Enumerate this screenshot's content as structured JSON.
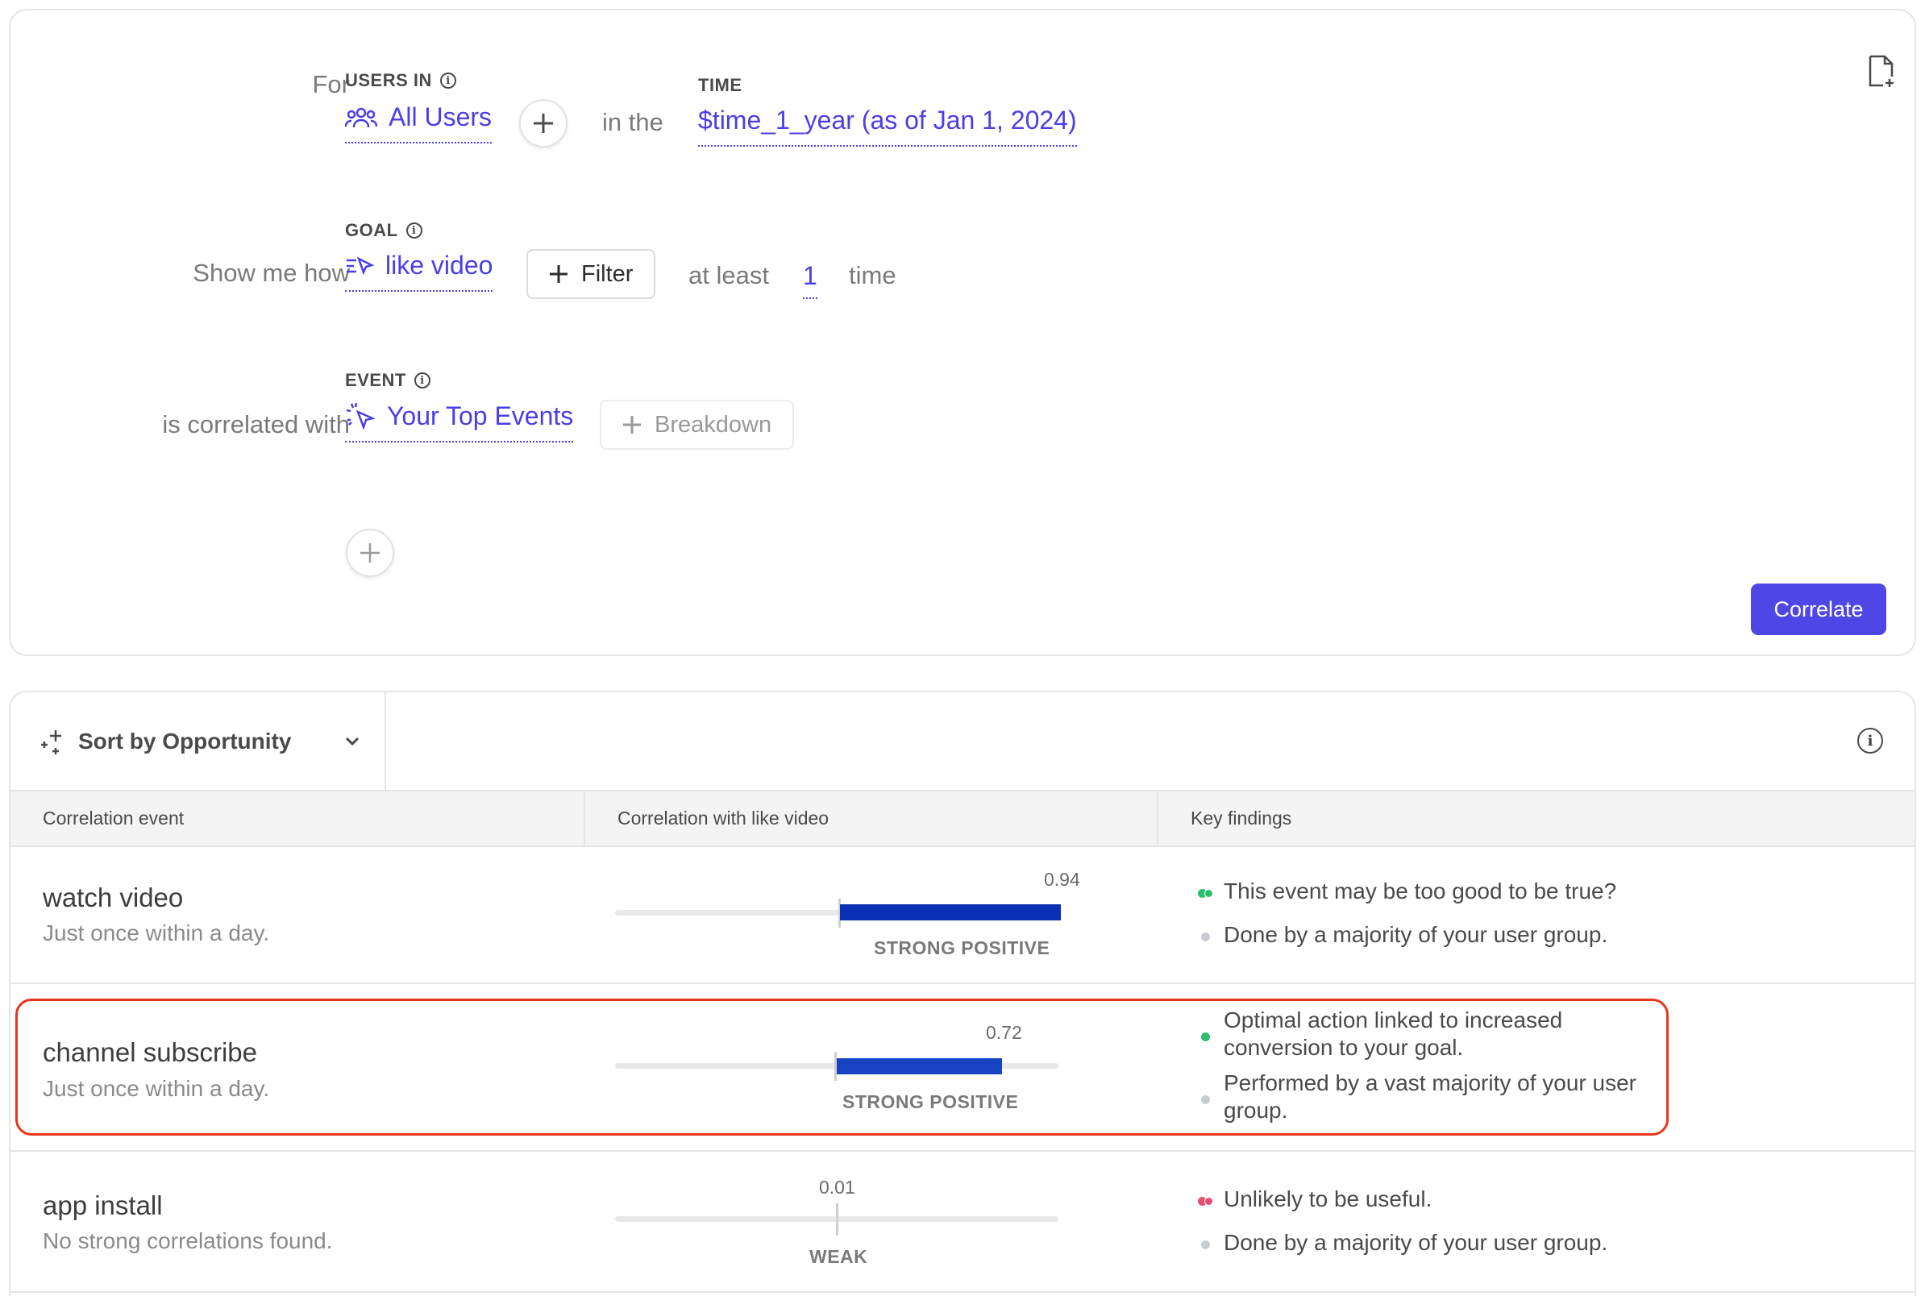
{
  "query": {
    "row1": {
      "label": "For",
      "users_caption": "USERS IN",
      "users_value": "All Users",
      "connector": "in the",
      "time_caption": "TIME",
      "time_value": "$time_1_year (as of Jan 1, 2024)"
    },
    "row2": {
      "label": "Show me how",
      "goal_caption": "GOAL",
      "goal_value": "like video",
      "filter_label": "Filter",
      "at_least": "at least",
      "count": "1",
      "unit": "time"
    },
    "row3": {
      "label": "is correlated with",
      "event_caption": "EVENT",
      "event_value": "Your Top Events",
      "breakdown_label": "Breakdown"
    },
    "correlate_label": "Correlate"
  },
  "results": {
    "sort_label": "Sort by Opportunity",
    "columns": [
      "Correlation event",
      "Correlation with like video",
      "Key findings"
    ],
    "rows": [
      {
        "name": "watch video",
        "sub": "Just once within a day.",
        "value": "0.94",
        "strength": "STRONG POSITIVE",
        "findings": [
          {
            "text": "This event may be too good to be true?",
            "status": "green-double"
          },
          {
            "text": "Done by a majority of your user group.",
            "status": "neutral"
          }
        ]
      },
      {
        "name": "channel subscribe",
        "sub": "Just once within a day.",
        "value": "0.72",
        "strength": "STRONG POSITIVE",
        "findings": [
          {
            "text": "Optimal action linked to increased conversion to your goal.",
            "status": "green"
          },
          {
            "text": "Performed by a vast majority of your user group.",
            "status": "neutral"
          }
        ]
      },
      {
        "name": "app install",
        "sub": "No strong correlations found.",
        "value": "0.01",
        "strength": "WEAK",
        "findings": [
          {
            "text": "Unlikely to be useful.",
            "status": "pink-double"
          },
          {
            "text": "Done by a majority of your user group.",
            "status": "neutral"
          }
        ]
      }
    ]
  },
  "colors": {
    "accent": "#4b3ee6",
    "primary_button": "#5046e5",
    "bar": "#1844c4",
    "highlight": "#e8361c"
  }
}
